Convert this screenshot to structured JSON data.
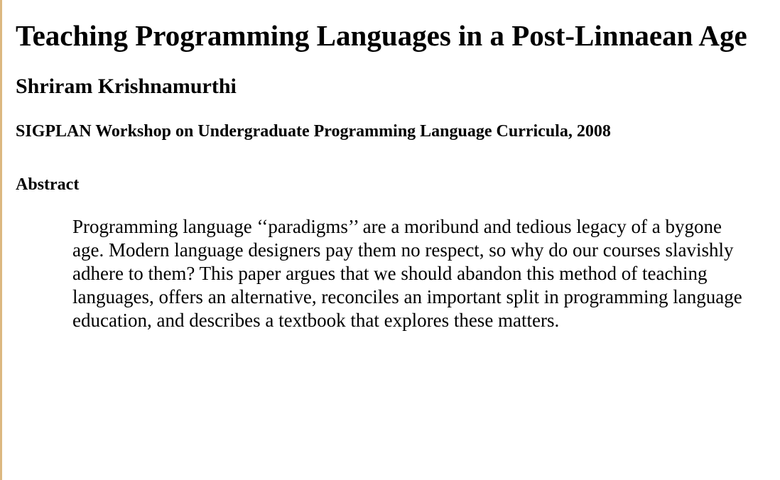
{
  "paper": {
    "title": "Teaching Programming Languages in a Post-Linnaean Age",
    "author": "Shriram Krishnamurthi",
    "venue": "SIGPLAN Workshop on Undergraduate Programming Language Curricula, 2008",
    "abstract_heading": "Abstract",
    "abstract_text": "Programming language ‘‘paradigms’’ are a moribund and tedious legacy of a bygone age. Modern language designers pay them no respect, so why do our courses slavishly adhere to them? This paper argues that we should abandon this method of teaching languages, offers an alternative, reconciles an important split in programming language education, and describes a textbook that explores these matters."
  },
  "colors": {
    "left_rule": "#dcb880",
    "background": "#ffffff",
    "text": "#000000"
  }
}
